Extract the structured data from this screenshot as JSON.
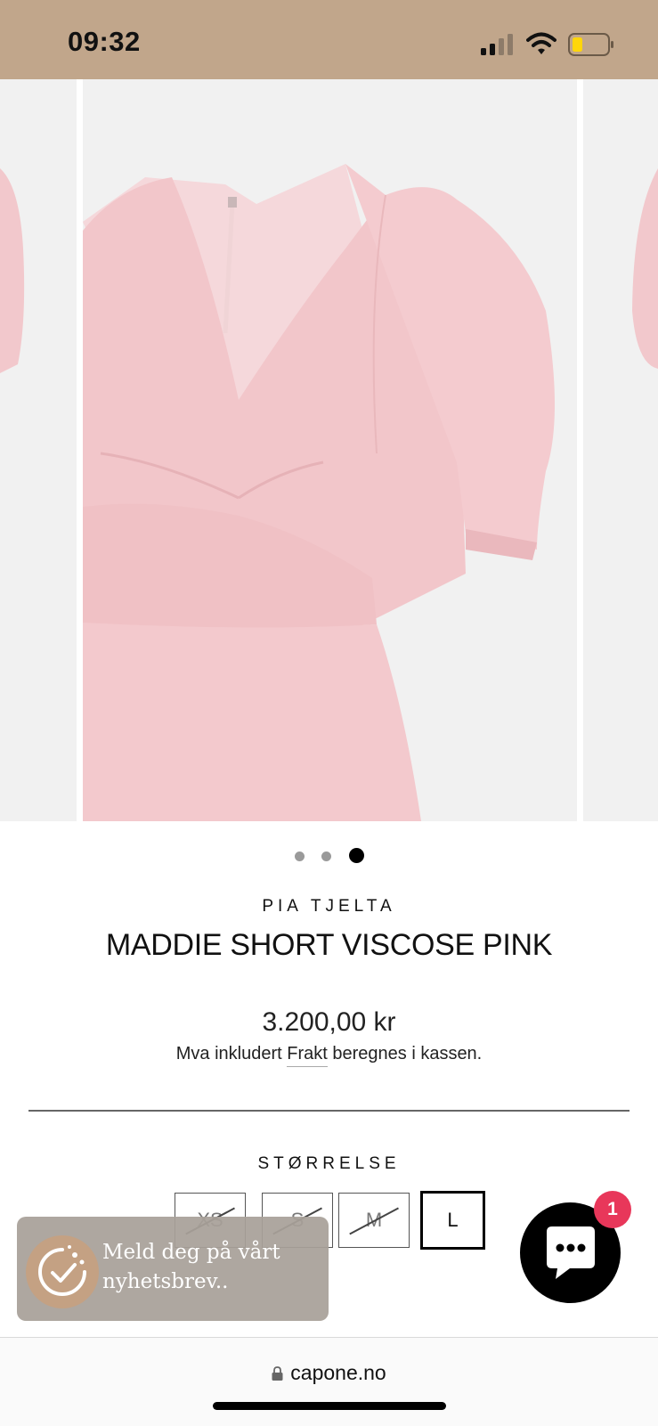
{
  "status": {
    "time": "09:32"
  },
  "gallery": {
    "slide_count": 3,
    "active_index": 2
  },
  "product": {
    "brand": "PIA TJELTA",
    "title": "MADDIE SHORT VISCOSE PINK",
    "price": "3.200,00 kr",
    "tax_prefix": "Mva inkludert",
    "tax_link": "Frakt",
    "tax_suffix": "beregnes i kassen."
  },
  "sizes": {
    "label": "STØRRELSE",
    "options": [
      {
        "label": "XS",
        "available": false,
        "selected": false
      },
      {
        "label": "S",
        "available": false,
        "selected": false
      },
      {
        "label": "M",
        "available": false,
        "selected": false
      },
      {
        "label": "L",
        "available": true,
        "selected": true
      }
    ]
  },
  "newsletter": {
    "text": "Meld deg på vårt nyhetsbrev.."
  },
  "chat": {
    "badge_count": "1"
  },
  "browser": {
    "url": "capone.no"
  },
  "colors": {
    "status_bar": "#c1a68b",
    "dress_pink": "#f2c9cd",
    "badge_red": "#e8375a",
    "newsletter_icon": "#c4a183"
  },
  "icons": {
    "zoom": "search-icon",
    "chat": "chat-bubble-icon",
    "lock": "lock-icon",
    "newsletter": "cookie-check-icon"
  }
}
